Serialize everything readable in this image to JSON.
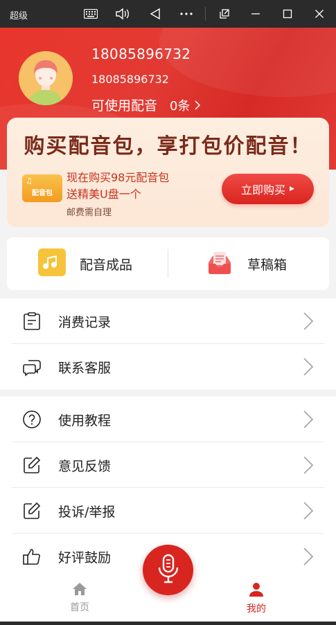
{
  "window": {
    "title": "超级",
    "icons": [
      "keyboard-icon",
      "volume-icon",
      "back-triangle-icon",
      "more-icon",
      "popout-icon",
      "minimize-icon",
      "maximize-icon",
      "close-icon"
    ]
  },
  "profile": {
    "display_name": "18085896732",
    "account": "18085896732",
    "available_label": "可使用配音",
    "available_count": "0条"
  },
  "promo": {
    "headline": "购买配音包，享打包价配音！",
    "badge_text": "配音包",
    "line1": "现在购买98元配音包",
    "line2": "送精美U盘一个",
    "note": "邮费需自理",
    "buy_label": "立即购买"
  },
  "shortcuts": [
    {
      "label": "配音成品",
      "icon": "music-note-icon"
    },
    {
      "label": "草稿箱",
      "icon": "draft-tray-icon"
    }
  ],
  "menu_group1": [
    {
      "label": "消费记录",
      "icon": "clipboard-icon"
    },
    {
      "label": "联系客服",
      "icon": "chat-bubbles-icon"
    }
  ],
  "menu_group2": [
    {
      "label": "使用教程",
      "icon": "question-circle-icon"
    },
    {
      "label": "意见反馈",
      "icon": "edit-icon"
    },
    {
      "label": "投诉/举报",
      "icon": "edit-icon"
    },
    {
      "label": "好评鼓励",
      "icon": "thumbs-up-icon"
    }
  ],
  "bottom_nav": {
    "home_label": "首页",
    "mine_label": "我的"
  },
  "colors": {
    "primary_red": "#d9251f",
    "header_red": "#e23a33",
    "promo_bg": "#fde7d6",
    "inactive_nav": "#9a9a9a"
  }
}
